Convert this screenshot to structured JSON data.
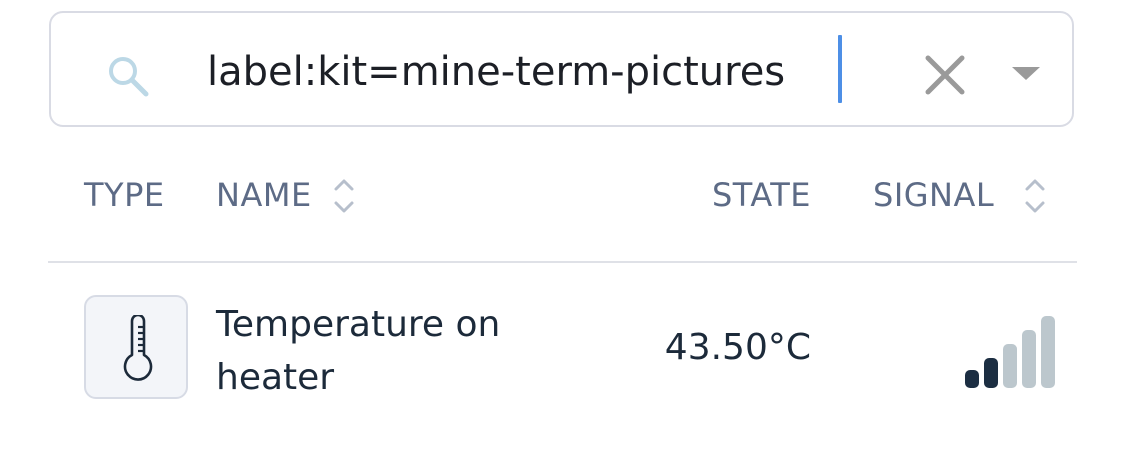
{
  "search": {
    "value": "label:kit=mine-term-pictures",
    "icon": "search-icon",
    "clear_icon": "close-icon",
    "dropdown_icon": "caret-down-icon"
  },
  "table": {
    "headers": {
      "type": "TYPE",
      "name": "NAME",
      "state": "STATE",
      "signal": "SIGNAL"
    },
    "rows": [
      {
        "type_icon": "thermometer-icon",
        "name": "Temperature on heater",
        "state": "43.50°C",
        "signal_bars_active": 2,
        "signal_bars_total": 5
      }
    ]
  },
  "colors": {
    "accent_caret": "#4d8fe6",
    "header_text": "#5d6b86",
    "body_text": "#1c2a3a",
    "signal_active": "#1c2e42",
    "signal_inactive": "#bcc7cd"
  }
}
